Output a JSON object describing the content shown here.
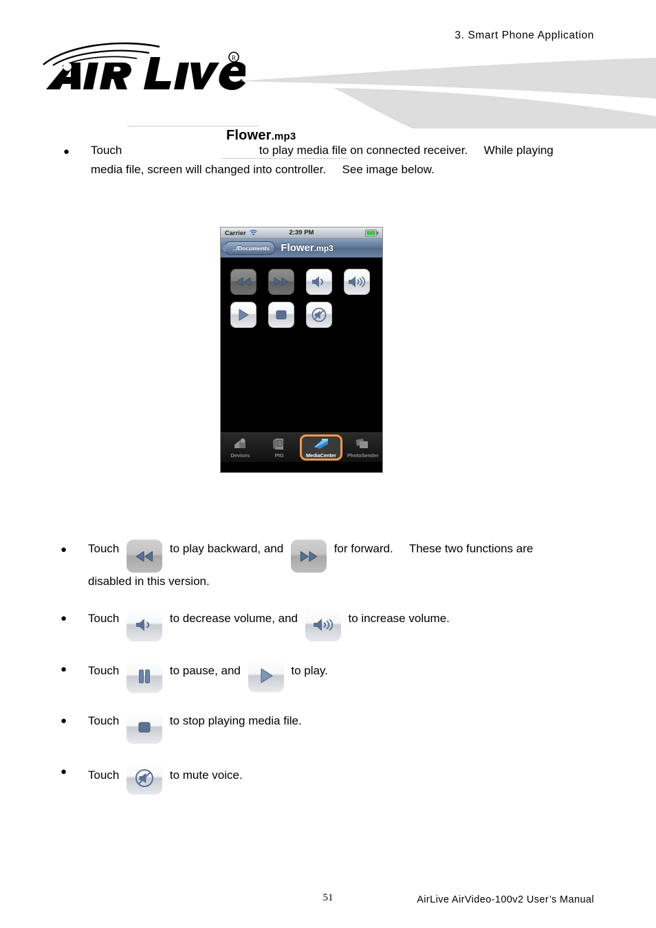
{
  "header": {
    "chapter": "3.  Smart  Phone  Application",
    "logo_text": "AirLive",
    "logo_mark": "registered-trademark"
  },
  "intro": {
    "bullet": "●",
    "touch_label": "Touch",
    "file_name": "Flower",
    "file_ext": ".mp3",
    "sentence_1": "to play media file on connected receiver.",
    "sentence_2": "While playing",
    "sentence_3": "media file, screen will changed into controller.",
    "sentence_4": "See image below."
  },
  "phone": {
    "statusbar": {
      "carrier": "Carrier",
      "wifi_icon": "wifi-icon",
      "time": "2:39 PM",
      "battery_icon": "battery-full-icon"
    },
    "navbar": {
      "back_label": "../Documents",
      "title_name": "Flower",
      "title_ext": ".mp3"
    },
    "controls": [
      {
        "name": "rewind",
        "icon": "rewind-icon",
        "state": "disabled"
      },
      {
        "name": "fast-forward",
        "icon": "fast-forward-icon",
        "state": "disabled"
      },
      {
        "name": "volume-down",
        "icon": "volume-down-icon",
        "state": "enabled"
      },
      {
        "name": "volume-up",
        "icon": "volume-up-icon",
        "state": "enabled"
      },
      {
        "name": "play",
        "icon": "play-icon",
        "state": "enabled"
      },
      {
        "name": "stop",
        "icon": "stop-icon",
        "state": "enabled"
      },
      {
        "name": "mute",
        "icon": "mute-icon",
        "state": "enabled"
      }
    ],
    "tabs": [
      {
        "label": "Devices",
        "icon": "devices-icon",
        "active": false
      },
      {
        "label": "PtG",
        "icon": "ptg-icon",
        "active": false
      },
      {
        "label": "MediaCenter",
        "icon": "mediacenter-icon",
        "active": true
      },
      {
        "label": "PhotoSender",
        "icon": "photosender-icon",
        "active": false
      }
    ],
    "active_tab_highlight_color": "#f2994a"
  },
  "steps": [
    {
      "bullet": "●",
      "lead": "Touch",
      "icon_a": "rewind-icon",
      "mid": "to play backward, and",
      "icon_b": "fast-forward-icon",
      "tail": "for forward.",
      "tail2": "These two functions are",
      "line2": "disabled in this version."
    },
    {
      "bullet": "●",
      "lead": "Touch",
      "icon_a": "volume-down-icon",
      "mid": "to decrease volume, and",
      "icon_b": "volume-up-icon",
      "tail": "to increase volume."
    },
    {
      "bullet": "●",
      "lead": "Touch",
      "icon_a": "pause-icon",
      "mid": "to pause, and",
      "icon_b": "play-icon",
      "tail": "to play."
    },
    {
      "bullet": "●",
      "lead": "Touch",
      "icon_a": "stop-icon",
      "mid": "to stop playing media file."
    },
    {
      "bullet": "●",
      "lead": "Touch",
      "icon_a": "mute-icon",
      "mid": "to mute voice."
    }
  ],
  "footer": {
    "page_number": "51",
    "manual_title": "AirLive  AirVideo-100v2  User’s  Manual"
  },
  "colors": {
    "accent_orange": "#f2994a",
    "icon_blue": "#5b7193",
    "swoosh_gray": "#dddddd",
    "battery_green": "#3ec63e"
  }
}
